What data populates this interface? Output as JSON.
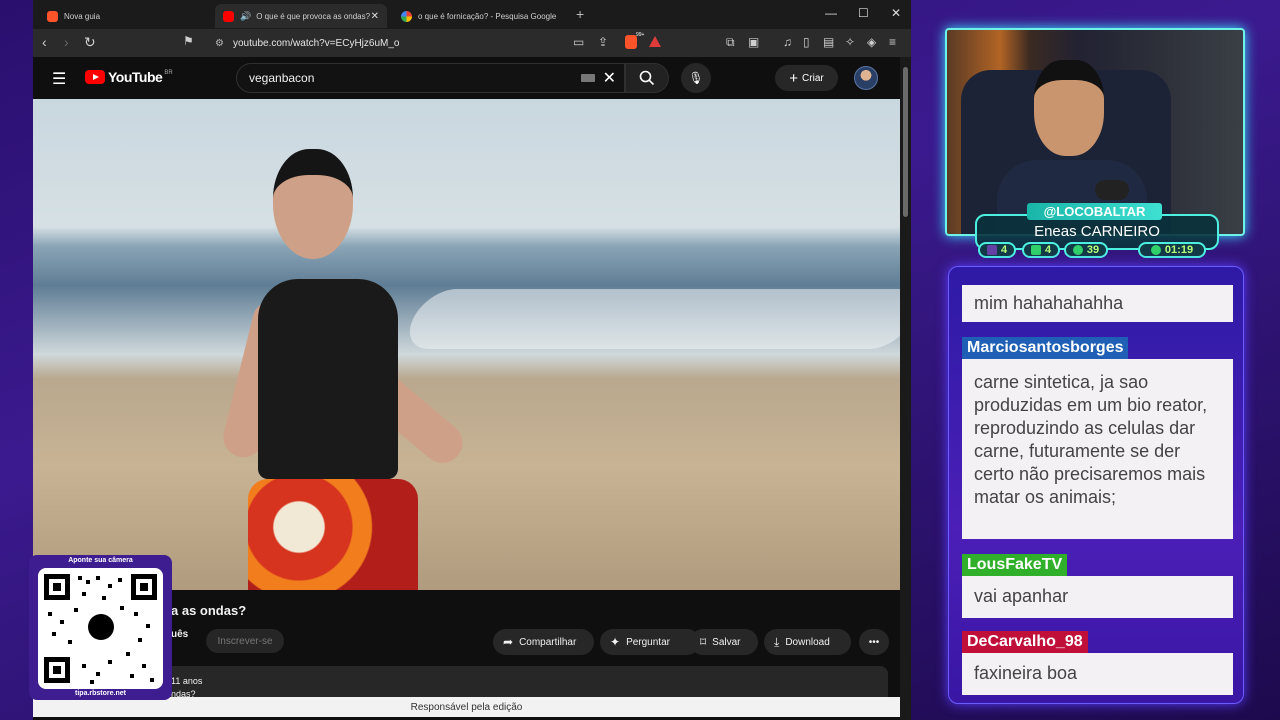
{
  "browser": {
    "tabs": [
      {
        "title": "Nova guia"
      },
      {
        "title": "O que é que provoca as ondas? - Yo"
      },
      {
        "title": "o que é fornicação? - Pesquisa Google"
      }
    ],
    "url": "youtube.com/watch?v=ECyHjz6uM_o",
    "brave_count": "99+"
  },
  "youtube": {
    "logo": "YouTube",
    "region": "BR",
    "search_value": "veganbacon",
    "create_label": "Criar",
    "video_title_visible": "a as ondas?",
    "channel_partial": "uês",
    "subscribe_label": "Inscrever-se",
    "actions": {
      "share": "Compartilhar",
      "ask": "Perguntar",
      "save": "Salvar",
      "download": "Download"
    },
    "desc_line1": "11 anos",
    "desc_line2": "ndas?",
    "footer_tip": "Responsável pela edição"
  },
  "qr": {
    "caption": "Aponte sua câmera",
    "url": "tipa.rbstore.net"
  },
  "streamer": {
    "handle": "@LOCOBALTAR",
    "name": "Eneas CARNEIRO",
    "stats": [
      {
        "icon": "twitch-icon",
        "value": "4"
      },
      {
        "icon": "youtube-icon",
        "value": "4"
      },
      {
        "icon": "viewers-icon",
        "value": "39"
      },
      {
        "icon": "clock-icon",
        "value": "01:19"
      }
    ]
  },
  "chat": {
    "messages": [
      {
        "user": "",
        "user_color": "",
        "text": "mim hahahahahha"
      },
      {
        "user": "Marciosantosborges",
        "user_color": "#1f5fb5",
        "text": "carne sintetica, ja sao produzidas em um bio reator, reproduzindo as celulas dar carne, futuramente se der certo não precisaremos mais matar os animais;"
      },
      {
        "user": "LousFakeTV",
        "user_color": "#30b02a",
        "text": "vai apanhar"
      },
      {
        "user": "DeCarvalho_98",
        "user_color": "#c0103a",
        "text": "faxineira boa"
      }
    ]
  }
}
